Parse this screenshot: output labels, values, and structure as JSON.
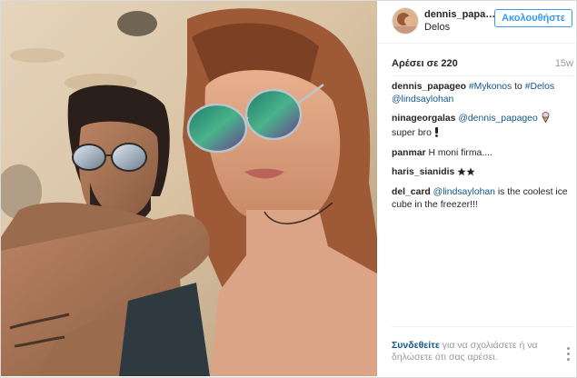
{
  "post": {
    "username": "dennis_papageo",
    "username_display": "dennis_papa…",
    "location": "Delos",
    "follow_label": "Ακολουθήστε",
    "likes": "Αρέσει σε 220",
    "age": "15w"
  },
  "comments": [
    {
      "user": "dennis_papageo",
      "parts": [
        {
          "t": "#Mykonos",
          "link": true
        },
        {
          "t": " to ",
          "link": false
        },
        {
          "t": "#Delos",
          "link": true
        },
        {
          "t": " ",
          "link": false
        },
        {
          "t": "@lindsaylohan",
          "link": true
        }
      ]
    },
    {
      "user": "ninageorgalas",
      "parts": [
        {
          "t": "@dennis_papageo",
          "link": true
        },
        {
          "t": " [ice-cream-icon] super bro [exclamation-icon]",
          "link": false
        }
      ],
      "icons": [
        "ice-cream-icon",
        "exclamation-icon"
      ]
    },
    {
      "user": "panmar",
      "parts": [
        {
          "t": "H moni firma....",
          "link": false
        }
      ]
    },
    {
      "user": "haris_sianidis",
      "parts": [
        {
          "t": "[star-icon][star-icon]",
          "link": false
        }
      ],
      "icons": [
        "star-icon",
        "star-icon"
      ]
    },
    {
      "user": "del_card",
      "parts": [
        {
          "t": "@lindsaylohan",
          "link": true
        },
        {
          "t": " is the coolest ice cube in the freezer!!!",
          "link": false
        }
      ]
    }
  ],
  "footer": {
    "login_label": "Συνδεθείτε",
    "rest": " για να σχολιάσετε ή να δηλώσετε ότι σας αρέσει."
  },
  "colors": {
    "accent": "#3897f0",
    "link": "#125688",
    "muted": "#999999"
  }
}
